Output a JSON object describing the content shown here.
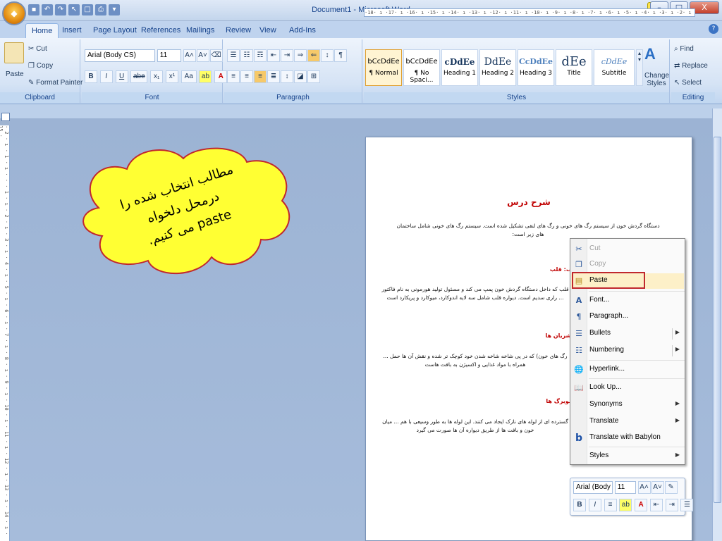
{
  "window": {
    "title": "Document1 - Microsoft Word",
    "office_button_icon": "office-logo-icon",
    "qat_icons": [
      "save-icon",
      "undo-icon",
      "redo-icon",
      "cursor-icon",
      "new-icon",
      "print-preview-icon",
      "customize-icon"
    ],
    "controls": {
      "minimize": "–",
      "maximize": "□",
      "close": "X"
    }
  },
  "tabs": [
    "Home",
    "Insert",
    "Page Layout",
    "References",
    "Mailings",
    "Review",
    "View",
    "Add-Ins"
  ],
  "active_tab": "Home",
  "ribbon": {
    "clipboard": {
      "label": "Clipboard",
      "paste": "Paste",
      "cut": "Cut",
      "copy": "Copy",
      "format_painter": "Format Painter"
    },
    "font": {
      "label": "Font",
      "font_name": "Arial (Body CS)",
      "font_size": "11",
      "bold": "B",
      "italic": "I",
      "underline": "U",
      "strikethrough": "abe",
      "subscript": "x₁",
      "superscript": "x¹",
      "change_case": "Aa"
    },
    "paragraph": {
      "label": "Paragraph"
    },
    "styles": {
      "label": "Styles",
      "items": [
        {
          "sample": "bCcDdEe",
          "name": "¶ Normal"
        },
        {
          "sample": "bCcDdEe",
          "name": "¶ No Spaci..."
        },
        {
          "sample": "cDdEe",
          "name": "Heading 1"
        },
        {
          "sample": "DdEe",
          "name": "Heading 2"
        },
        {
          "sample": "CcDdEe",
          "name": "Heading 3"
        },
        {
          "sample": "dEe",
          "name": "Title"
        },
        {
          "sample": "cDdEe",
          "name": "Subtitle"
        }
      ],
      "change_styles": "Change Styles"
    },
    "editing": {
      "label": "Editing",
      "find": "Find",
      "replace": "Replace",
      "select": "Select"
    }
  },
  "ruler": {
    "horizontal": "·18· ı ·17· ı ·16· ı ·15· ı ·14· ı ·13· ı ·12· ı ·11· ı ·10· ı ·9· ı ·8· ı ·7· ı ·6· ı ·5· ı ·4· ı ·3· ı ·2· ı ·1· ı · ı ·1· ı ·2·",
    "vertical": "· 2 · ı · 1 · ı · · · 1 · ı · 2 · ı · 3 · ı · 4 · ı · 5 · ı · 6 · ı · 7 · ı · 8 · ı · 9 · ı · 10 · ı · 11 · ı · 12 · ı · 13 · ı · 14 · ı · 15 ·"
  },
  "document": {
    "title": "شرح درس",
    "intro": "دستگاه گردش خون از سیستم رگ های خونی و رگ های لنفی تشکیل شده است. سیستم رگ های خونی شامل ساختمان های زیر است:",
    "sections": [
      {
        "heading": "الف: قلب",
        "text": "قلب که داخل دستگاه گردش خون پمپ می کند و مسئول تولید هورمونی به نام فاکتور ... راری سدیم است. دیواره قلب شامل سه لایه اندوکارد، میوکارد و پریکارد است"
      },
      {
        "heading": "ب: شریان ها",
        "text": "رگ های خون) که در پی شاخه شاخه شدن خود کوچک تر شده و نقش آن ها حمل ... همراه با مواد غذایی و اکسیژن به بافت هاست"
      },
      {
        "heading": "ج: مویرگ ها",
        "text": "گسترده ای از لوله های نازک ایجاد می کنند. این لوله ها به طور وسیعی با هم ... میان خون و بافت ها از طریق دیواره آن ها صورت می گیرد"
      }
    ]
  },
  "context_menu": {
    "items": [
      {
        "label": "Cut",
        "icon": "scissors-icon",
        "disabled": true
      },
      {
        "label": "Copy",
        "icon": "copy-icon",
        "disabled": true
      },
      {
        "label": "Paste",
        "icon": "paste-icon",
        "disabled": false,
        "highlighted": true
      },
      {
        "label": "Font...",
        "icon": "font-icon"
      },
      {
        "label": "Paragraph...",
        "icon": "paragraph-icon"
      },
      {
        "label": "Bullets",
        "icon": "bullets-icon",
        "submenu": true
      },
      {
        "label": "Numbering",
        "icon": "numbering-icon",
        "submenu": true
      },
      {
        "label": "Hyperlink...",
        "icon": "hyperlink-icon"
      },
      {
        "label": "Look Up...",
        "icon": "lookup-icon"
      },
      {
        "label": "Synonyms",
        "submenu": true
      },
      {
        "label": "Translate",
        "submenu": true
      },
      {
        "label": "Translate with Babylon",
        "icon": "babylon-icon"
      },
      {
        "label": "Styles",
        "submenu": true
      }
    ],
    "highlight_color": "#c0282e"
  },
  "mini_toolbar": {
    "font_name": "Arial (Body",
    "font_size": "11",
    "bold": "B",
    "italic": "I"
  },
  "callout": {
    "text_line1": "مطالب انتخاب شده را",
    "text_line2": "درمحل دلخواه",
    "text_line3": "paste می کنیم.",
    "fill_color": "#ffff33"
  }
}
